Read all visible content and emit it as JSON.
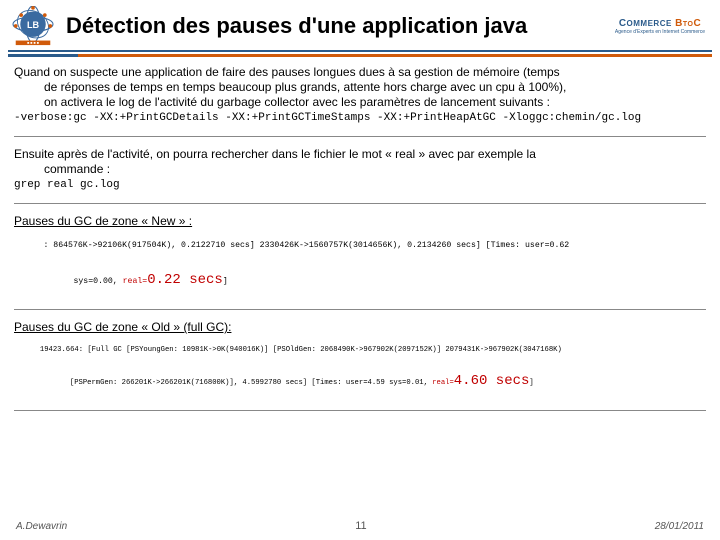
{
  "header": {
    "title": "Détection des pauses d'une application java",
    "brand_a": "C",
    "brand_b": "OMMERCE",
    "brand_c": " B",
    "brand_d": "TO",
    "brand_e": "C",
    "brand_sub": "Agence d'Experts en Internet Commerce"
  },
  "p_intro1": "Quand on suspecte une application de faire des pauses longues dues à sa gestion de mémoire (temps",
  "p_intro2": "de réponses de temps en temps beaucoup plus grands, attente hors charge avec un cpu à 100%),",
  "p_intro3": "on activera le log de l'activité du garbage collector avec les paramètres de lancement suivants :",
  "code_flags": "-verbose:gc -XX:+PrintGCDetails -XX:+PrintGCTimeStamps -XX:+PrintHeapAtGC -Xloggc:chemin/gc.log",
  "p_then1": "Ensuite après de l'activité, on pourra rechercher dans le fichier le mot « real » avec par exemple la",
  "p_then2": "commande :",
  "code_grep": "grep real gc.log",
  "h_new": "Pauses du GC de zone « New » :",
  "new_line_a": ": 864576K->92106K(917504K), 0.2122710 secs] 2330426K->1560757K(3014656K), 0.2134260 secs] [Times: user=0.62",
  "new_line_b1": "sys=0.00, ",
  "new_line_b2": "real=",
  "new_line_b3": "0.22 secs",
  "new_line_b4": "]",
  "h_old": "Pauses du GC de zone « Old » (full GC):",
  "old_line_a": "19423.664: [Full GC [PSYoungGen: 10981K->0K(940016K)] [PSOldGen: 2068490K->967902K(2097152K)] 2079431K->967902K(3047168K)",
  "old_line_b1": "[PSPermGen: 266201K->266201K(716800K)], 4.5992780 secs] [Times: user=4.59 sys=0.01, ",
  "old_line_b2": "real=",
  "old_line_b3": "4.60 secs",
  "old_line_b4": "]",
  "footer": {
    "author": "A.Dewavrin",
    "page": "11",
    "date": "28/01/2011"
  }
}
